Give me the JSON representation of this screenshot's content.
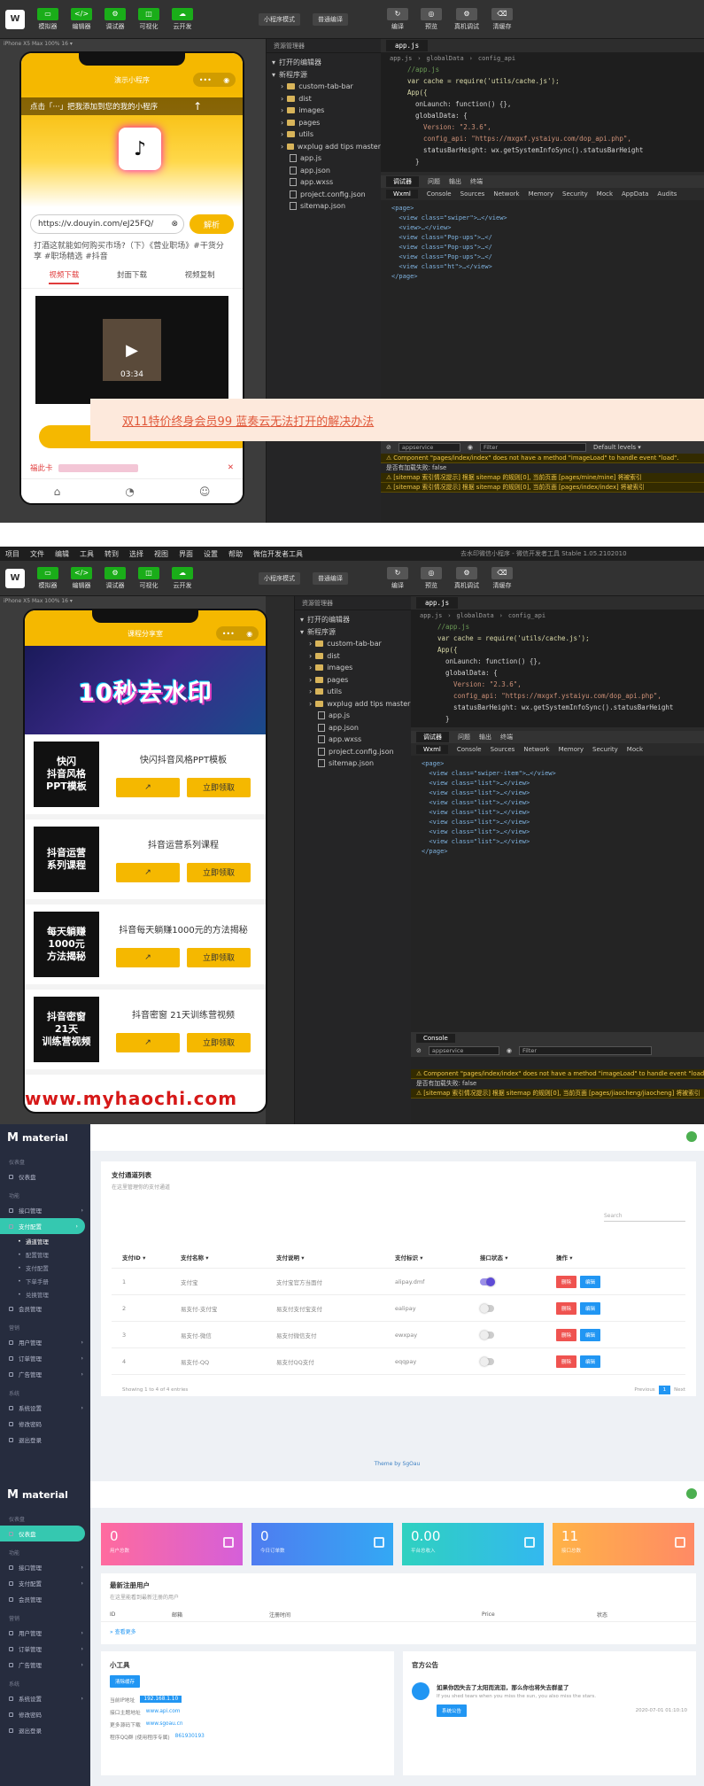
{
  "ide_top": {
    "toolbar_buttons": [
      "模拟器",
      "编辑器",
      "调试器",
      "可视化",
      "云开发"
    ],
    "mode_select": "小程序模式",
    "compile_select": "普通编译",
    "right_buttons": [
      "编译",
      "预览",
      "真机调试",
      "清缓存"
    ],
    "device_label": "iPhone X5 Max 100% 16 ▾",
    "phone": {
      "title": "演示小程序",
      "tip": "点击「···」把我添加到您的我的小程序",
      "url_value": "https://v.douyin.com/eJ25FQ/",
      "parse_label": "解析",
      "desc": "打酒这就能如何购买市场?（下）《营业职场》#干货分享 #职场精选 #抖音",
      "tabs": [
        "视频下载",
        "封面下载",
        "视频复制"
      ],
      "video_time": "03:34",
      "ad_prefix": "福此卡"
    },
    "tree_head": "资源管理器",
    "tree_sections": [
      "打开的编辑器",
      "新程序源"
    ],
    "tree_items": [
      {
        "type": "folder",
        "name": "custom-tab-bar"
      },
      {
        "type": "folder",
        "name": "dist"
      },
      {
        "type": "folder",
        "name": "images"
      },
      {
        "type": "folder",
        "name": "pages"
      },
      {
        "type": "folder",
        "name": "utils"
      },
      {
        "type": "folder",
        "name": "wxplug add tips master"
      },
      {
        "type": "file",
        "name": "app.js"
      },
      {
        "type": "file",
        "name": "app.json"
      },
      {
        "type": "file",
        "name": "app.wxss"
      },
      {
        "type": "file",
        "name": "project.config.json"
      },
      {
        "type": "file",
        "name": "sitemap.json"
      }
    ],
    "editor_tab": "app.js",
    "crumbs": [
      "app.js",
      "globalData",
      "config_api"
    ],
    "code": [
      "//app.js",
      "var cache = require('utils/cache.js');",
      "App({",
      "  onLaunch: function() {},",
      "  globalData: {",
      "    Version: \"2.3.6\",",
      "    config_api: \"https://mxgxf.ystaiyu.com/dop_api.php\",",
      "    statusBarHeight: wx.getSystemInfoSync().statusBarHeight",
      "  }"
    ],
    "dt_tabs": [
      "调试器",
      "问题",
      "输出",
      "终端"
    ],
    "dt_subtabs": [
      "Wxml",
      "Console",
      "Sources",
      "Network",
      "Memory",
      "Security",
      "Mock",
      "AppData",
      "Audits"
    ],
    "dom": [
      "<page>",
      "  <view class=\"swiper\">…</view>",
      "  <view>…</view>",
      "  <view class=\"Pop-ups\">…</",
      "  <view class=\"Pop-ups\">…</",
      "  <view class=\"Pop-ups\">…</",
      "  <view class=\"ht\">…</view>",
      "</page>"
    ],
    "console_context": "appservice",
    "console_filter": "Filter",
    "console_levels": "Default levels ▾",
    "console": [
      {
        "kind": "warn",
        "text": "Component \"pages/index/index\" does not have a method \"imageLoad\" to handle event \"load\"."
      },
      {
        "kind": "plain",
        "text": "是否有加载失败: false"
      },
      {
        "kind": "warn",
        "text": "[sitemap 索引情况提示] 根据 sitemap 的规则[0], 当前页面 [pages/mine/mine] 将被索引"
      },
      {
        "kind": "warn",
        "text": "[sitemap 索引情况提示] 根据 sitemap 的规则[0], 当前页面 [pages/index/index] 将被索引"
      }
    ],
    "overlay_text": "双11特价终身会员99 蓝奏云无法打开的解决办法"
  },
  "ide_bottom": {
    "menu": [
      "项目",
      "文件",
      "编辑",
      "工具",
      "转到",
      "选择",
      "视图",
      "界面",
      "设置",
      "帮助",
      "微信开发者工具"
    ],
    "window_title": "去水印微信小程序 - 微信开发者工具 Stable 1.05.2102010",
    "toolbar_buttons": [
      "模拟器",
      "编辑器",
      "调试器",
      "可视化",
      "云开发"
    ],
    "mode_select": "小程序模式",
    "compile_select": "普通编译",
    "right_buttons": [
      "编译",
      "预览",
      "真机调试",
      "清缓存"
    ],
    "device_label": "iPhone X5 Max 100% 16 ▾",
    "phone": {
      "title": "课程分享室",
      "banner_text": "10秒去水印",
      "courses": [
        {
          "thumb": "快闪\n抖音风格\nPPT模板",
          "title": "快闪抖音风格PPT模板",
          "btn": "立即领取"
        },
        {
          "thumb": "抖音运营\n系列课程",
          "title": "抖音运营系列课程",
          "btn": "立即领取"
        },
        {
          "thumb": "每天躺赚\n1000元\n方法揭秘",
          "title": "抖音每天躺赚1000元的方法揭秘",
          "btn": "立即领取"
        },
        {
          "thumb": "抖音密窗\n21天\n训练营视频",
          "title": "抖音密窗 21天训练营视频",
          "btn": "立即领取"
        }
      ]
    },
    "watermark": "www.myhaochi.com",
    "tree_head": "资源管理器",
    "tree_sections": [
      "打开的编辑器",
      "新程序源"
    ],
    "tree_items": [
      {
        "type": "folder",
        "name": "custom-tab-bar"
      },
      {
        "type": "folder",
        "name": "dist"
      },
      {
        "type": "folder",
        "name": "images"
      },
      {
        "type": "folder",
        "name": "pages"
      },
      {
        "type": "folder",
        "name": "utils"
      },
      {
        "type": "folder",
        "name": "wxplug add tips master"
      },
      {
        "type": "file",
        "name": "app.js"
      },
      {
        "type": "file",
        "name": "app.json"
      },
      {
        "type": "file",
        "name": "app.wxss"
      },
      {
        "type": "file",
        "name": "project.config.json"
      },
      {
        "type": "file",
        "name": "sitemap.json"
      }
    ],
    "editor_tab": "app.js",
    "crumbs": [
      "app.js",
      "globalData",
      "config_api"
    ],
    "code": [
      "//app.js",
      "var cache = require('utils/cache.js');",
      "App({",
      "  onLaunch: function() {},",
      "  globalData: {",
      "    Version: \"2.3.6\",",
      "    config_api: \"https://mxgxf.ystaiyu.com/dop_api.php\",",
      "    statusBarHeight: wx.getSystemInfoSync().statusBarHeight",
      "  }"
    ],
    "dt_tabs": [
      "调试器",
      "问题",
      "输出",
      "终端"
    ],
    "dt_subtabs": [
      "Wxml",
      "Console",
      "Sources",
      "Network",
      "Memory",
      "Security",
      "Mock"
    ],
    "dom": [
      "<page>",
      "  <view class=\"swiper-item\">…</view>",
      "  <view class=\"list\">…</view>",
      "  <view class=\"list\">…</view>",
      "  <view class=\"list\">…</view>",
      "  <view class=\"list\">…</view>",
      "  <view class=\"list\">…</view>",
      "  <view class=\"list\">…</view>",
      "  <view class=\"list\">…</view>",
      "</page>"
    ],
    "console_tab": "Console",
    "console_context": "appservice",
    "console_filter": "Filter",
    "console": [
      {
        "kind": "warn",
        "text": "Component \"pages/index/index\" does not have a method \"imageLoad\" to handle event \"load\"."
      },
      {
        "kind": "plain",
        "text": "是否有加载失败: false"
      },
      {
        "kind": "warn",
        "text": "[sitemap 索引情况提示] 根据 sitemap 的规则[0], 当前页面 [pages/jiaocheng/jiaocheng] 将被索引"
      }
    ]
  },
  "admin_top": {
    "logo": "material",
    "nav": [
      {
        "sec": "仪表盘"
      },
      {
        "item": "仪表盘"
      },
      {
        "sec": "功能"
      },
      {
        "item": "接口管理",
        "arrow": "›"
      },
      {
        "item": "支付配置",
        "active": true,
        "arrow": "›"
      },
      {
        "sub": "通道管理",
        "on": true
      },
      {
        "sub": "配置管理"
      },
      {
        "sub": "支付配置"
      },
      {
        "sub": "下单手册"
      },
      {
        "sub": "兑换管理"
      },
      {
        "item": "会员管理"
      },
      {
        "sec": "营销"
      },
      {
        "item": "用户管理",
        "arrow": "›"
      },
      {
        "item": "订单管理",
        "arrow": "›"
      },
      {
        "item": "广告管理",
        "arrow": "›"
      },
      {
        "sec": "系统"
      },
      {
        "item": "系统设置",
        "arrow": "›"
      },
      {
        "item": "修改密码"
      },
      {
        "item": "退出登录"
      }
    ],
    "card_title": "支付通道列表",
    "card_sub": "在这里管理你的支付通道",
    "search_placeholder": "Search",
    "columns": [
      "支付ID ▾",
      "支付名称 ▾",
      "支付说明 ▾",
      "支付标识 ▾",
      "接口状态 ▾",
      "操作 ▾"
    ],
    "rows": [
      {
        "id": "1",
        "name": "支付宝",
        "desc": "支付宝官方当面付",
        "key": "alipay.dmf",
        "on": true
      },
      {
        "id": "2",
        "name": "易支付-支付宝",
        "desc": "易支付支付宝支付",
        "key": "ealipay",
        "on": false
      },
      {
        "id": "3",
        "name": "易支付-微信",
        "desc": "易支付微信支付",
        "key": "ewxpay",
        "on": false
      },
      {
        "id": "4",
        "name": "易支付-QQ",
        "desc": "易支付QQ支付",
        "key": "eqqpay",
        "on": false
      }
    ],
    "delete_label": "删除",
    "edit_label": "编辑",
    "showing": "Showing 1 to 4 of 4 entries",
    "prev": "Previous",
    "page": "1",
    "next": "Next",
    "theme": "Theme by SgOau"
  },
  "admin_bottom": {
    "logo": "material",
    "nav": [
      {
        "sec": "仪表盘"
      },
      {
        "item": "仪表盘",
        "active": true
      },
      {
        "sec": "功能"
      },
      {
        "item": "接口管理",
        "arrow": "›"
      },
      {
        "item": "支付配置",
        "arrow": "›"
      },
      {
        "item": "会员管理"
      },
      {
        "sec": "营销"
      },
      {
        "item": "用户管理",
        "arrow": "›"
      },
      {
        "item": "订单管理",
        "arrow": "›"
      },
      {
        "item": "广告管理",
        "arrow": "›"
      },
      {
        "sec": "系统"
      },
      {
        "item": "系统设置",
        "arrow": "›"
      },
      {
        "item": "修改密码"
      },
      {
        "item": "退出登录"
      }
    ],
    "stats": [
      {
        "num": "0",
        "label": "用户总数",
        "color1": "#ff6b9e",
        "color2": "#d55fd9"
      },
      {
        "num": "0",
        "label": "今日订单数",
        "color1": "#4f7cf0",
        "color2": "#33a8f4"
      },
      {
        "num": "0.00",
        "label": "平台总收入",
        "color1": "#2fd1c0",
        "color2": "#33b8ef"
      },
      {
        "num": "11",
        "label": "接口总数",
        "color1": "#ffb347",
        "color2": "#ff8a65"
      }
    ],
    "recent_title": "最新注册用户",
    "recent_sub": "在这里能看到最新注册的用户",
    "recent_cols": [
      "ID",
      "邮箱",
      "注册时间",
      "Price",
      "状态"
    ],
    "recent_more": "» 查看更多",
    "tools_title": "小工具",
    "tools_btn": "清除缓存",
    "tools_rows": [
      {
        "k": "当前IP地址",
        "v": "192.168.1.10",
        "chip": true
      },
      {
        "k": "接口主题地址",
        "v": "www.api.com"
      },
      {
        "k": "更多源码下载",
        "v": "www.sgoau.cn"
      },
      {
        "k": "程序QQ群 (使用程序专属)",
        "v": "861930193"
      }
    ],
    "notice_title": "官方公告",
    "notice_headline": "如果你因失去了太阳而流泪，那么你也将失去群星了",
    "notice_sub": "If you shed tears when you miss the sun, you also miss the stars.",
    "notice_badge": "系统公告",
    "notice_time": "2020-07-01 01:10:10"
  }
}
